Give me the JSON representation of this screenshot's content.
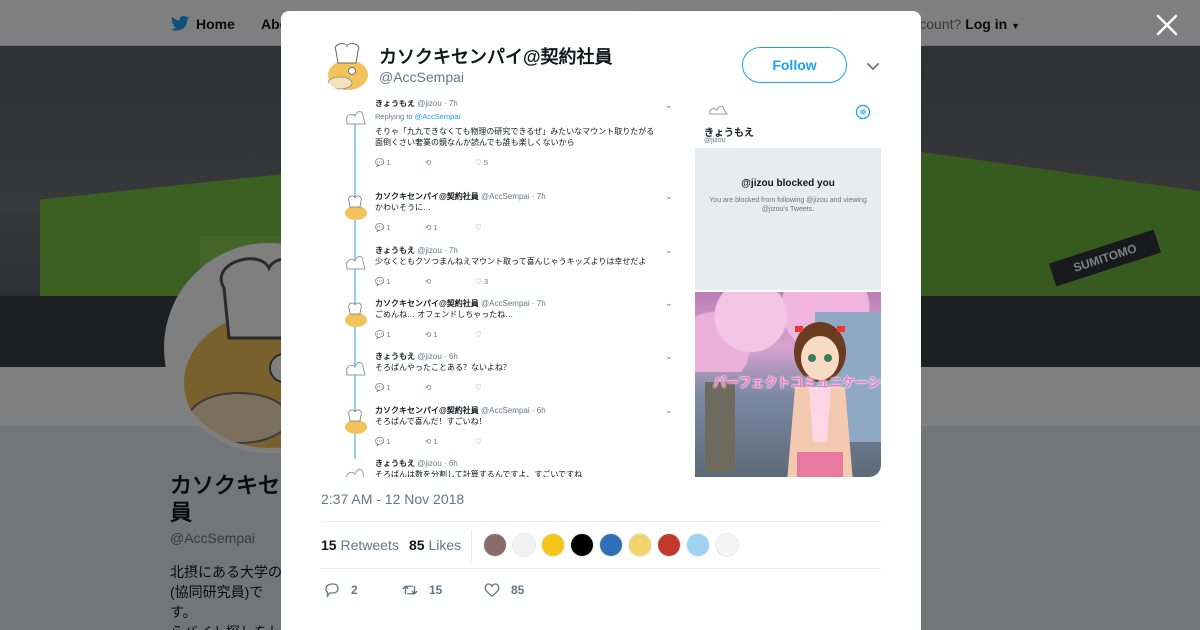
{
  "nav": {
    "home_label": "Home",
    "about_label": "Abo",
    "account_prompt": "ccount?",
    "login_label": "Log in"
  },
  "profile": {
    "display_name": "カソクキセ\n員",
    "handle": "@AccSempai",
    "bio": "北摂にある大学の\n(協同研究員)です。\nらバイト探しをし\n小企業の社長に気"
  },
  "banner": {
    "sign_text": "SUMITOMO"
  },
  "tweet": {
    "author_name": "カソクキセンパイ@契約社員",
    "author_handle": "@AccSempai",
    "follow_label": "Follow",
    "timestamp": "2:37 AM - 12 Nov 2018",
    "retweets_count": "15",
    "retweets_label": "Retweets",
    "likes_count": "85",
    "likes_label": "Likes",
    "reply_count": "2",
    "retweet_count": "15",
    "like_count": "85"
  },
  "screenshot_thread": [
    {
      "name": "きょうもえ",
      "handle": "@jizou · 7h",
      "replying": "Replying to",
      "replying_to": "@AccSempai",
      "text1": "そりゃ「九九できなくても物理の研究できるぜ」みたいなマウント取りたがる",
      "text2": "面倒くさい奢業の鏡なんか読んでも誰も楽しくないから",
      "actions": [
        "1",
        "",
        "5"
      ]
    },
    {
      "name": "カソクキセンパイ@契約社員",
      "handle": "@AccSempai · 7h",
      "text1": "かわいそうに…",
      "actions": [
        "1",
        "1",
        ""
      ]
    },
    {
      "name": "きょうもえ",
      "handle": "@jizou · 7h",
      "text1": "少なくともクソつまんねえマウント取って喜んじゃうキッズよりは幸せだよ",
      "actions": [
        "1",
        "",
        "3"
      ]
    },
    {
      "name": "カソクキセンパイ@契約社員",
      "handle": "@AccSempai · 7h",
      "text1": "ごめんね… オフェンドしちゃったね…",
      "actions": [
        "1",
        "1",
        ""
      ]
    },
    {
      "name": "きょうもえ",
      "handle": "@jizou · 6h",
      "text1": "そろばんやったことある？ないよね？",
      "actions": [
        "1",
        "",
        ""
      ]
    },
    {
      "name": "カソクキセンパイ@契約社員",
      "handle": "@AccSempai · 6h",
      "text1": "そろばんで喜んだ！すごいね！",
      "actions": [
        "1",
        "1",
        ""
      ]
    },
    {
      "name": "きょうもえ",
      "handle": "@jizou · 6h",
      "text1": "そろばんは数を分割して計算するんですよ、すごいですね",
      "actions": []
    }
  ],
  "blocked_panel": {
    "name": "きょうもえ",
    "handle": "@jizou",
    "title": "@jizou blocked you",
    "subtitle": "You are blocked from following @jizou and viewing @jizou's Tweets."
  },
  "image_panel": {
    "caption": "パーフェクトコミュニケーシ"
  },
  "liker_colors": [
    "#8a6b6b",
    "#f2f2f2",
    "#f5c518",
    "#000000",
    "#2f6fb5",
    "#f3d36b",
    "#c0392b",
    "#9fd4f0",
    "#f4f4f4"
  ],
  "colors": {
    "accent": "#1da1f2",
    "muted": "#657786",
    "text": "#14171a"
  }
}
